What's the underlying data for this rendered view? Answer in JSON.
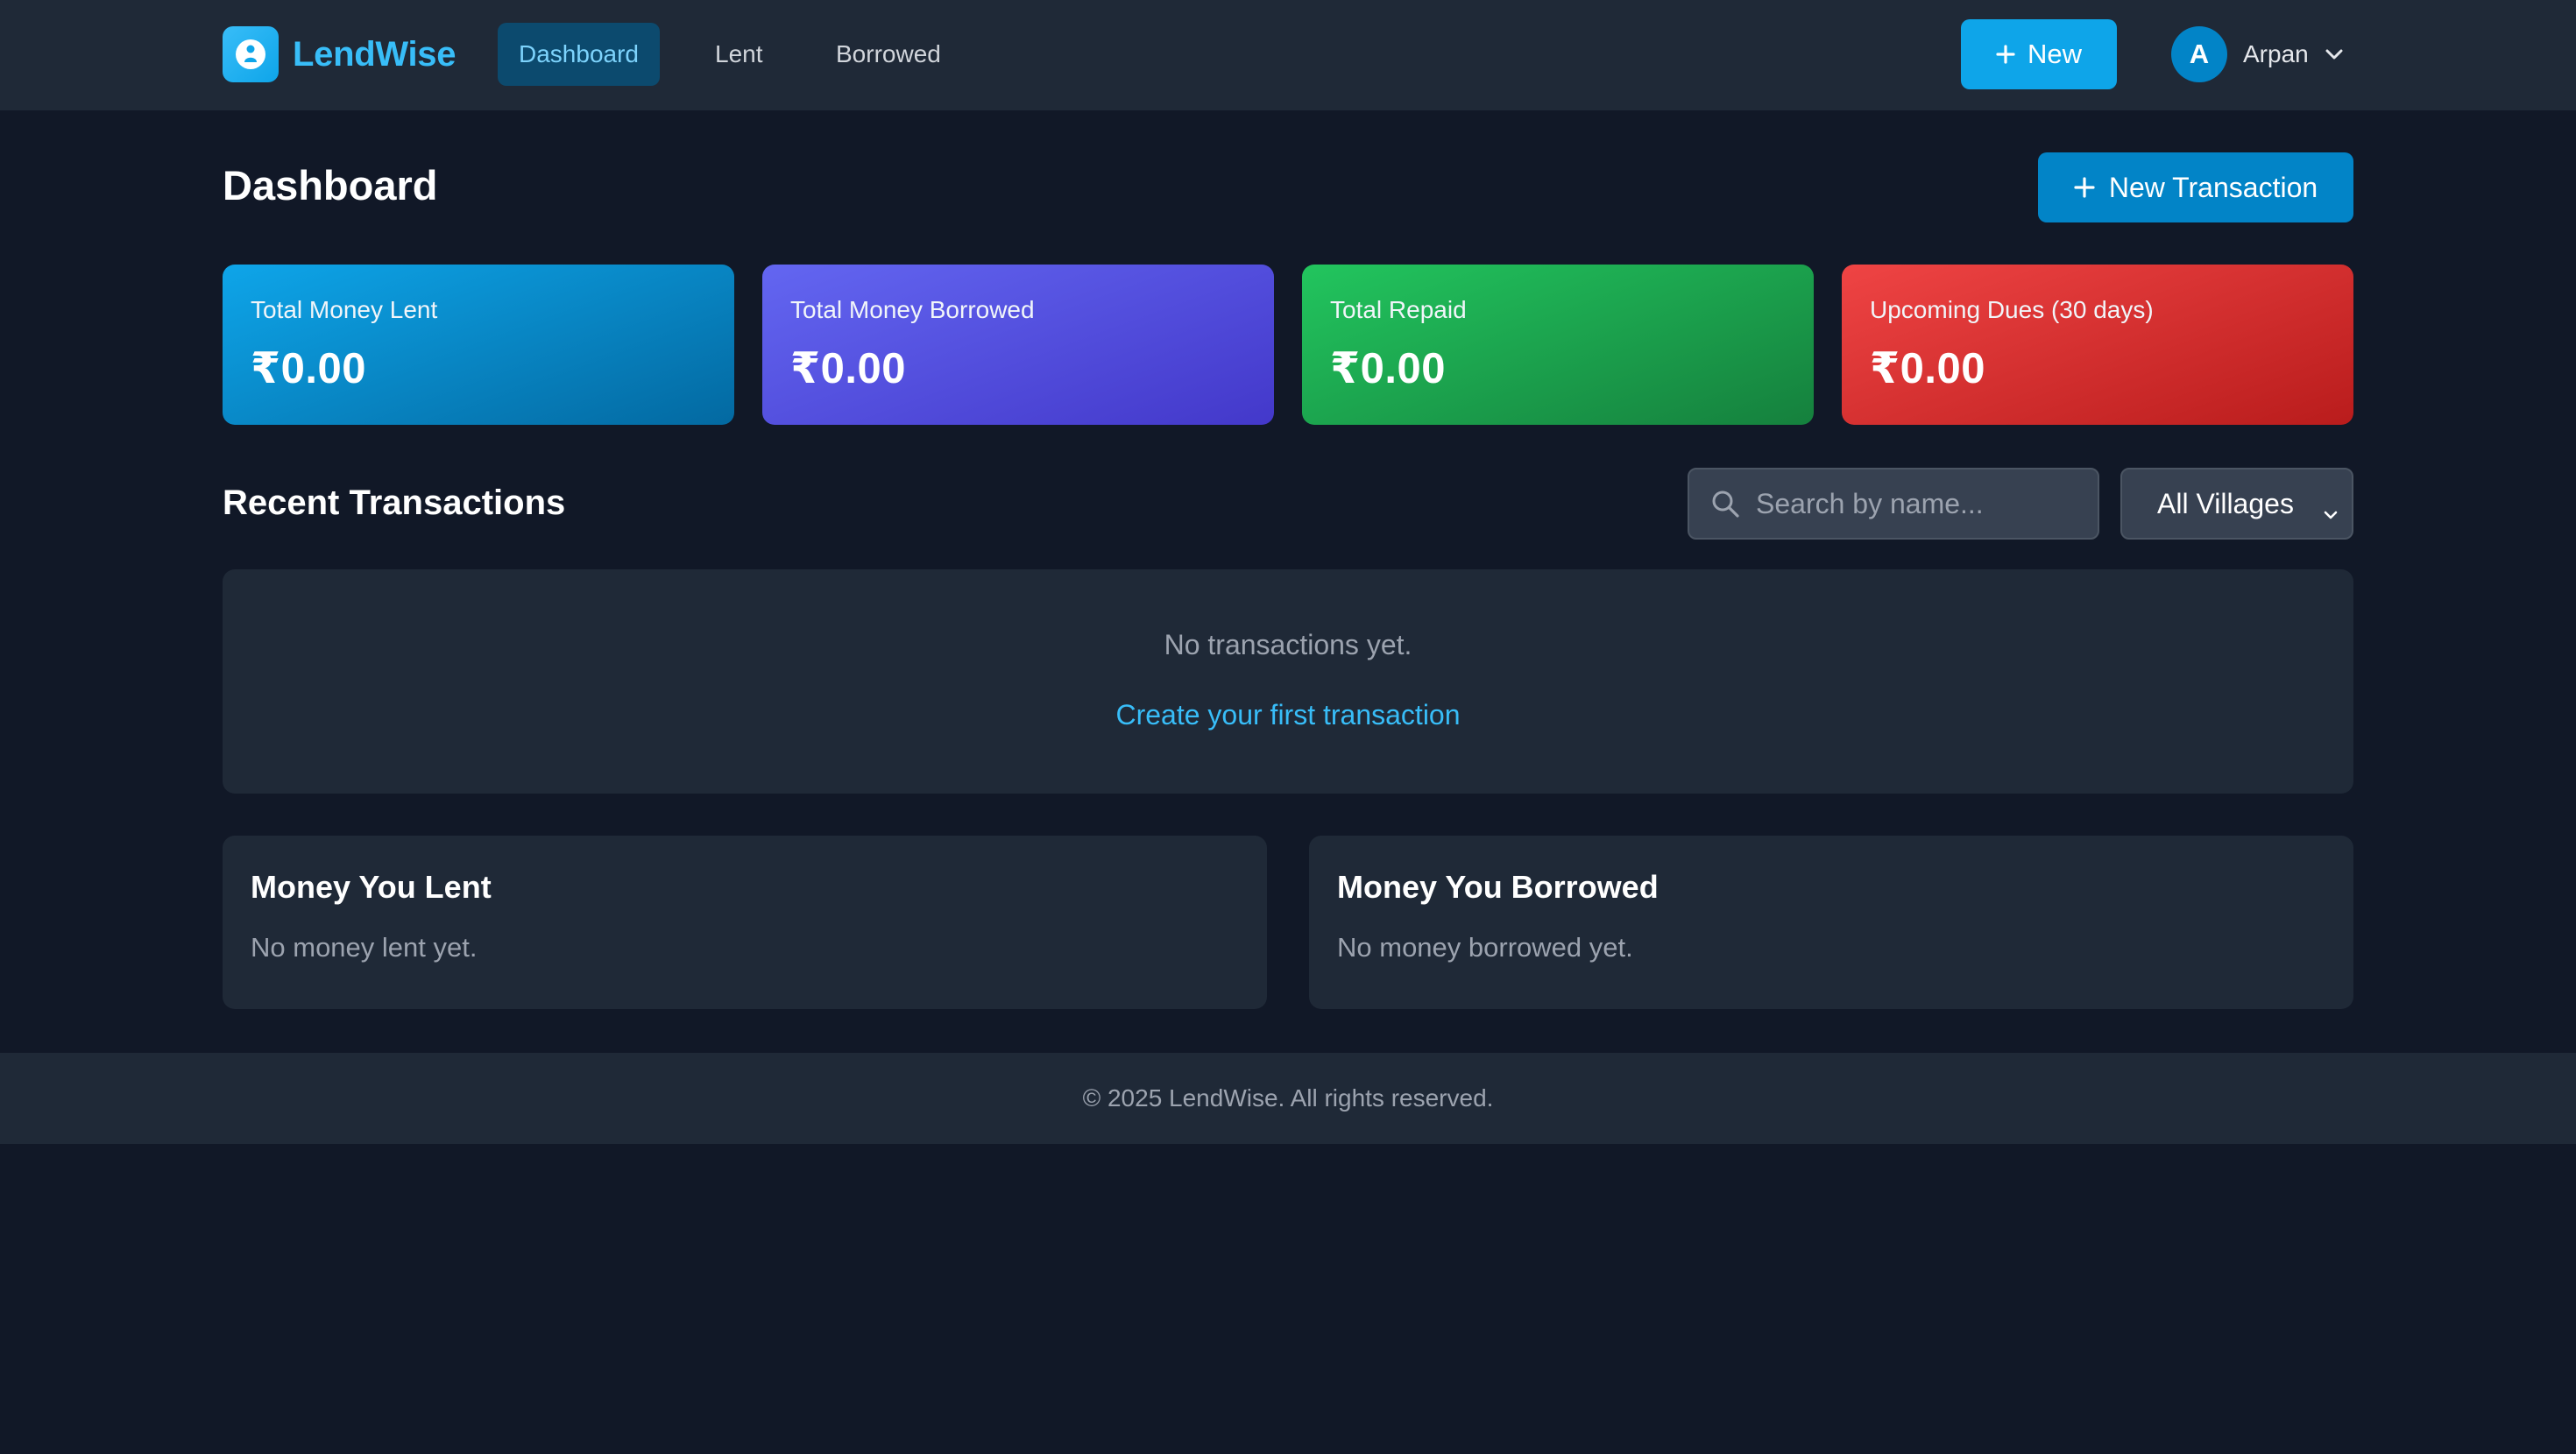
{
  "brand": {
    "name": "LendWise",
    "icon": "user-in-circle-icon"
  },
  "nav": {
    "links": [
      {
        "label": "Dashboard",
        "active": true
      },
      {
        "label": "Lent",
        "active": false
      },
      {
        "label": "Borrowed",
        "active": false
      }
    ],
    "new_button": "New",
    "user": {
      "initial": "A",
      "name": "Arpan"
    }
  },
  "page": {
    "title": "Dashboard",
    "new_transaction_button": "New Transaction"
  },
  "stats": [
    {
      "label": "Total Money Lent",
      "value": "₹0.00"
    },
    {
      "label": "Total Money Borrowed",
      "value": "₹0.00"
    },
    {
      "label": "Total Repaid",
      "value": "₹0.00"
    },
    {
      "label": "Upcoming Dues (30 days)",
      "value": "₹0.00"
    }
  ],
  "recent": {
    "title": "Recent Transactions",
    "search_placeholder": "Search by name...",
    "village_filter": "All Villages",
    "empty_text": "No transactions yet.",
    "empty_link": "Create your first transaction"
  },
  "lent_panel": {
    "title": "Money You Lent",
    "empty": "No money lent yet."
  },
  "borrowed_panel": {
    "title": "Money You Borrowed",
    "empty": "No money borrowed yet."
  },
  "footer": {
    "text": "© 2025 LendWise. All rights reserved."
  },
  "colors": {
    "background": "#111827",
    "surface": "#1f2937",
    "accent": "#0ea5e9",
    "card_lent": "#0ea5e9",
    "card_borrowed": "#6366f1",
    "card_repaid": "#22c55e",
    "card_dues": "#ef4444"
  }
}
